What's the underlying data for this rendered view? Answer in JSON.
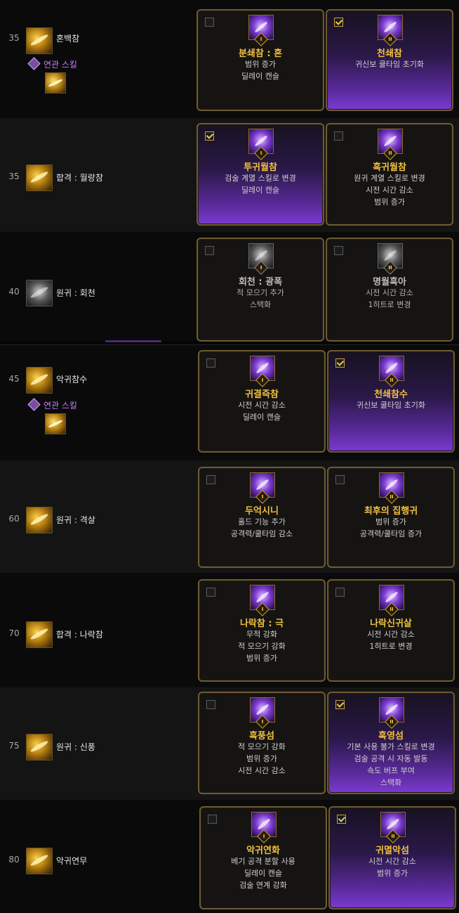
{
  "rows": [
    {
      "level": "35",
      "skill": "혼백참",
      "related_label": "연관 스킬",
      "icon": "golden-slash-icon",
      "talents": [
        {
          "name": "분쇄참 : 혼",
          "desc": [
            "범위 증가",
            "딜레이 캔슬"
          ],
          "checked": false,
          "tier": "I",
          "icon": "purple-slash-icon"
        },
        {
          "name": "천쇄참",
          "desc": [
            "귀신보 쿨타임 초기화"
          ],
          "checked": true,
          "tier": "II",
          "icon": "purple-slash-icon"
        }
      ]
    },
    {
      "level": "35",
      "skill": "합격 : 월랑참",
      "icon": "golden-moon-slash-icon",
      "talents": [
        {
          "name": "투귀월참",
          "desc": [
            "검술 계열 스킬로 변경",
            "딜레이 캔슬"
          ],
          "checked": true,
          "tier": "I",
          "icon": "purple-moon-slash-icon"
        },
        {
          "name": "흑귀월참",
          "desc": [
            "원귀 계열 스킬로 변경",
            "시전 시간 감소",
            "범위 증가"
          ],
          "checked": false,
          "tier": "II",
          "icon": "purple-moon-slash-icon"
        }
      ]
    },
    {
      "level": "40",
      "skill": "원귀 : 회천",
      "icon": "gray-whirl-icon",
      "talents": [
        {
          "name": "회천 : 광폭",
          "desc": [
            "적 모으기 추가",
            "스택화"
          ],
          "checked": false,
          "tier": "I",
          "icon": "gray-whirl-icon"
        },
        {
          "name": "명월흑아",
          "desc": [
            "시전 시간 감소",
            "1히트로 변경"
          ],
          "checked": false,
          "tier": "II",
          "icon": "gray-whirl-icon"
        }
      ]
    },
    {
      "level": "45",
      "skill": "악귀참수",
      "related_label": "연관 스킬",
      "icon": "golden-beheading-icon",
      "talents": [
        {
          "name": "귀결즉참",
          "desc": [
            "시전 시간 감소",
            "딜레이 캔슬"
          ],
          "checked": false,
          "tier": "I",
          "icon": "purple-beheading-icon"
        },
        {
          "name": "천쇄참수",
          "desc": [
            "귀신보 쿨타임 초기화"
          ],
          "checked": true,
          "tier": "II",
          "icon": "purple-beheading-icon"
        }
      ]
    },
    {
      "level": "60",
      "skill": "원귀 : 격살",
      "icon": "golden-pillar-icon",
      "talents": [
        {
          "name": "두억시니",
          "desc": [
            "홀드 기능 추가",
            "공격력/쿨타임 감소"
          ],
          "checked": false,
          "tier": "I",
          "icon": "purple-pillar-icon"
        },
        {
          "name": "최후의 집행귀",
          "desc": [
            "범위 증가",
            "공격력/쿨타임 증가"
          ],
          "checked": false,
          "tier": "II",
          "icon": "purple-pillar-icon"
        }
      ]
    },
    {
      "level": "70",
      "skill": "합격 : 나락참",
      "icon": "golden-abyss-slash-icon",
      "talents": [
        {
          "name": "나락참 : 극",
          "desc": [
            "무적 강화",
            "적 모으기 강화",
            "범위 증가"
          ],
          "checked": false,
          "tier": "I",
          "icon": "purple-abyss-slash-icon"
        },
        {
          "name": "나락신귀살",
          "desc": [
            "시전 시간 감소",
            "1히트로 변경"
          ],
          "checked": false,
          "tier": "II",
          "icon": "purple-abyss-slash-icon"
        }
      ]
    },
    {
      "level": "75",
      "skill": "원귀 : 신풍",
      "icon": "golden-wind-icon",
      "talents": [
        {
          "name": "흑풍섬",
          "desc": [
            "적 모으기 강화",
            "범위 증가",
            "시전 시간 감소"
          ],
          "checked": false,
          "tier": "I",
          "icon": "purple-wind-icon"
        },
        {
          "name": "흑영섬",
          "desc": [
            "기본 사용 불가 스킬로 변경",
            "검술 공격 시 자동 발동",
            "속도 버프 부여",
            "스택화"
          ],
          "checked": true,
          "tier": "II",
          "icon": "purple-wind-icon"
        }
      ]
    },
    {
      "level": "80",
      "skill": "악귀연무",
      "icon": "golden-dance-icon",
      "talents": [
        {
          "name": "악귀연화",
          "desc": [
            "베기 공격 분할 사용",
            "딜레이 캔슬",
            "검술 연계 강화"
          ],
          "checked": false,
          "tier": "I",
          "icon": "purple-dance-icon"
        },
        {
          "name": "귀멸악섬",
          "desc": [
            "시전 시간 감소",
            "범위 증가"
          ],
          "checked": true,
          "tier": "II",
          "icon": "purple-dance-icon"
        }
      ]
    }
  ]
}
